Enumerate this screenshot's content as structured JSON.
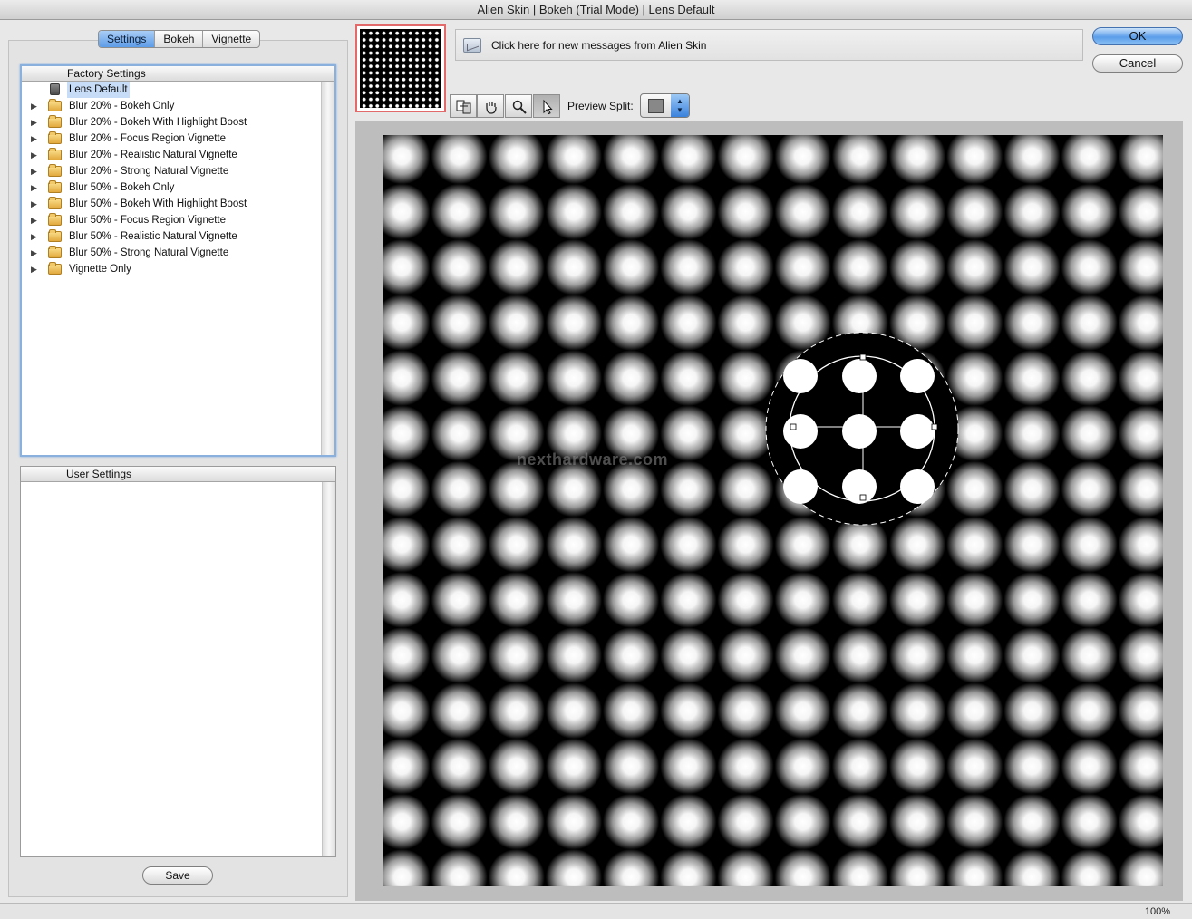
{
  "window": {
    "title": "Alien Skin | Bokeh (Trial Mode) | Lens Default"
  },
  "tabs": [
    {
      "label": "Settings",
      "active": true
    },
    {
      "label": "Bokeh",
      "active": false
    },
    {
      "label": "Vignette",
      "active": false
    }
  ],
  "factory_settings": {
    "header": "Factory Settings",
    "items": [
      {
        "label": "Lens Default",
        "icon": "preset-document-icon",
        "expandable": false,
        "selected": true
      },
      {
        "label": "Blur 20% - Bokeh Only",
        "icon": "folder-icon",
        "expandable": true,
        "selected": false
      },
      {
        "label": "Blur 20% - Bokeh With Highlight Boost",
        "icon": "folder-icon",
        "expandable": true,
        "selected": false
      },
      {
        "label": "Blur 20% - Focus Region Vignette",
        "icon": "folder-icon",
        "expandable": true,
        "selected": false
      },
      {
        "label": "Blur 20% - Realistic Natural Vignette",
        "icon": "folder-icon",
        "expandable": true,
        "selected": false
      },
      {
        "label": "Blur 20% - Strong Natural Vignette",
        "icon": "folder-icon",
        "expandable": true,
        "selected": false
      },
      {
        "label": "Blur 50% - Bokeh Only",
        "icon": "folder-icon",
        "expandable": true,
        "selected": false
      },
      {
        "label": "Blur 50% - Bokeh With Highlight Boost",
        "icon": "folder-icon",
        "expandable": true,
        "selected": false
      },
      {
        "label": "Blur 50% - Focus Region Vignette",
        "icon": "folder-icon",
        "expandable": true,
        "selected": false
      },
      {
        "label": "Blur 50% - Realistic Natural Vignette",
        "icon": "folder-icon",
        "expandable": true,
        "selected": false
      },
      {
        "label": "Blur 50% - Strong Natural Vignette",
        "icon": "folder-icon",
        "expandable": true,
        "selected": false
      },
      {
        "label": "Vignette Only",
        "icon": "folder-icon",
        "expandable": true,
        "selected": false
      }
    ]
  },
  "user_settings": {
    "header": "User Settings",
    "items": []
  },
  "buttons": {
    "save": "Save",
    "ok": "OK",
    "cancel": "Cancel"
  },
  "message_bar": {
    "text": "Click here for new messages from Alien Skin"
  },
  "toolbar": {
    "tools": [
      {
        "name": "compare-tool-icon",
        "pressed": false
      },
      {
        "name": "hand-tool-icon",
        "pressed": false
      },
      {
        "name": "zoom-tool-icon",
        "pressed": false
      },
      {
        "name": "pointer-tool-icon",
        "pressed": true
      }
    ],
    "preview_split_label": "Preview Split:"
  },
  "preview": {
    "watermark": "nexthardware.com",
    "grid_columns": 12,
    "grid_rows": 12
  },
  "status": {
    "zoom": "100%"
  },
  "colors": {
    "accent": "#5d9ce8",
    "selection": "#c6dcf7",
    "thumbnail_border": "#e36a6a"
  }
}
